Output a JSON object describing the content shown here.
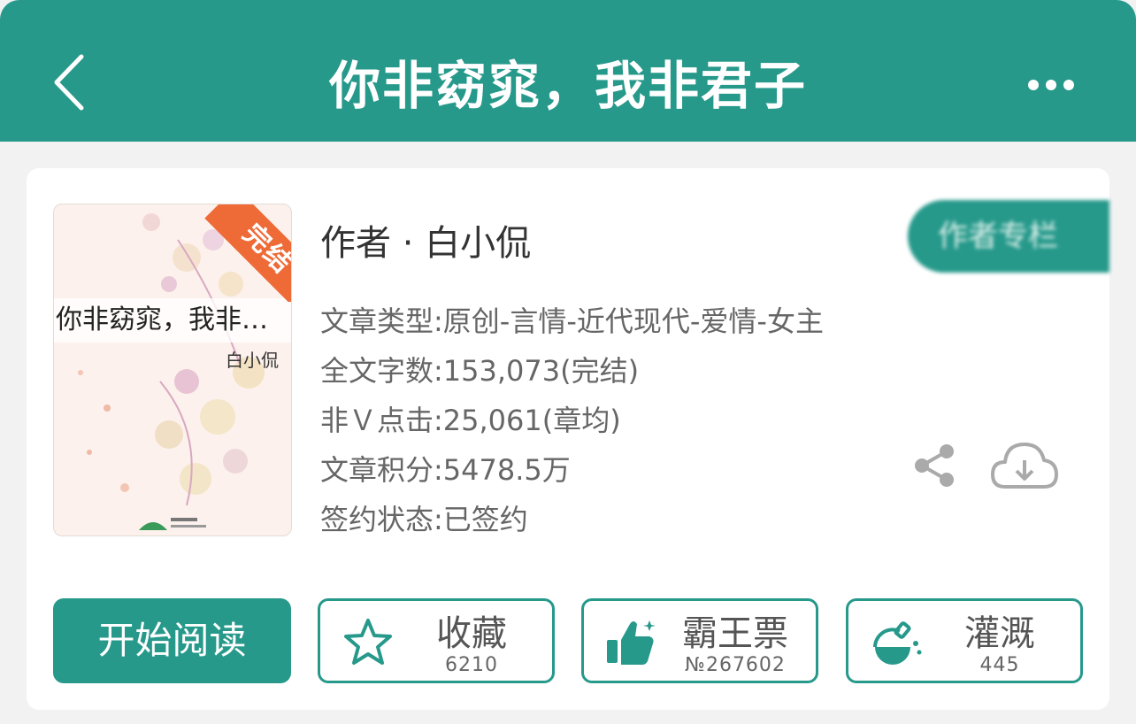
{
  "header": {
    "title": "你非窈窕，我非君子"
  },
  "book": {
    "cover": {
      "title": "你非窈窕，我非…",
      "author": "白小侃",
      "ribbon": "完结"
    },
    "author_line": "作者 · 白小侃",
    "tag_button": "作者专栏",
    "meta": {
      "category": "文章类型:原创-言情-近代现代-爱情-女主",
      "word_count": "全文字数:153,073(完结)",
      "clicks": "非Ｖ点击:25,061(章均)",
      "score": "文章积分:5478.5万",
      "sign_status": "签约状态:已签约"
    }
  },
  "actions": {
    "read": "开始阅读",
    "favorite": {
      "label": "收藏",
      "count": "6210"
    },
    "ticket": {
      "label": "霸王票",
      "count": "№267602"
    },
    "irrigate": {
      "label": "灌溉",
      "count": "445"
    }
  },
  "icons": {
    "back": "chevron-left-icon",
    "more": "more-dots-icon",
    "share": "share-icon",
    "download": "cloud-download-icon",
    "favorite": "star-icon",
    "ticket": "thumbs-up-icon",
    "irrigate": "flask-icon"
  },
  "colors": {
    "accent": "#26998b",
    "ribbon": "#ee6a36"
  }
}
